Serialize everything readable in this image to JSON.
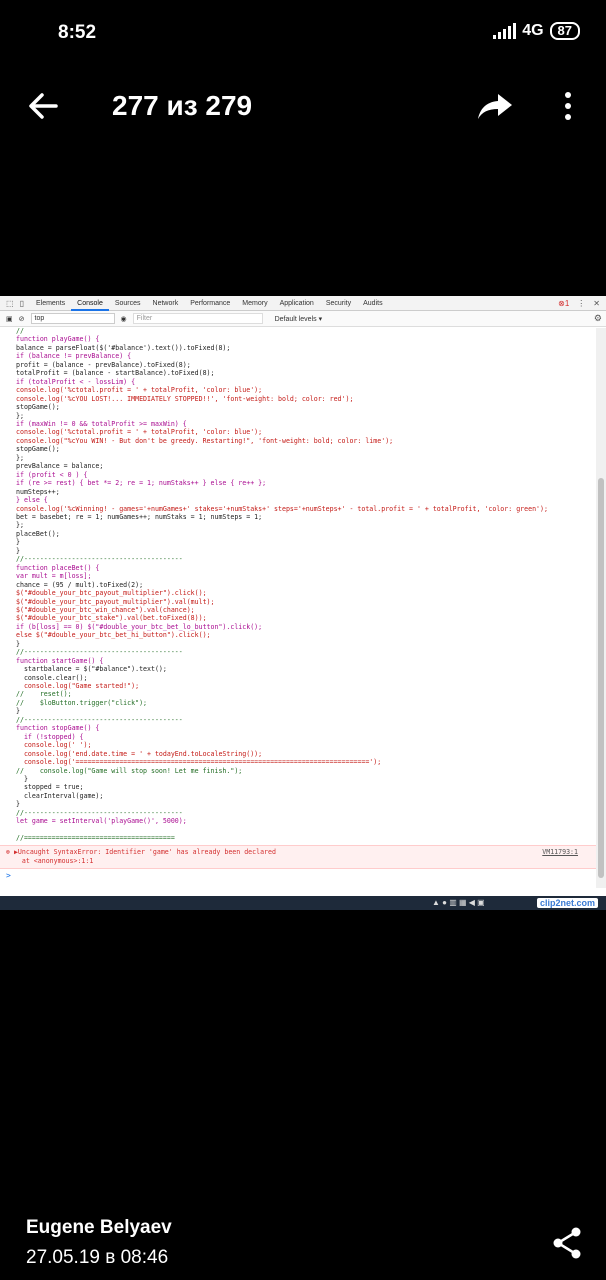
{
  "status_bar": {
    "time": "8:52",
    "network": "4G",
    "battery": "87"
  },
  "app_bar": {
    "counter": "277 из 279"
  },
  "photo": {
    "devtools": {
      "tabs": [
        "Elements",
        "Console",
        "Sources",
        "Network",
        "Performance",
        "Memory",
        "Application",
        "Security",
        "Audits"
      ],
      "active_tab": "Console",
      "error_count": "1",
      "context": "top",
      "filter_placeholder": "Filter",
      "levels": "Default levels ▾"
    },
    "code_lines": [
      "//",
      "function playGame() {",
      "balance = parseFloat($('#balance').text()).toFixed(8);",
      "if (balance != prevBalance) {",
      "profit = (balance - prevBalance).toFixed(8);",
      "totalProfit = (balance - startBalance).toFixed(8);",
      "if (totalProfit < - lossLim) {",
      "console.log('%ctotal.profit = ' + totalProfit, 'color: blue');",
      "console.log('%cYOU LOST!... IMMEDIATELY STOPPED!!', 'font-weight: bold; color: red');",
      "stopGame();",
      "};",
      "if (maxWin != 0 && totalProfit >= maxWin) {",
      "console.log('%ctotal.profit = ' + totalProfit, 'color: blue');",
      "console.log(\"%cYou WIN! - But don't be greedy. Restarting!\", 'font-weight: bold; color: lime');",
      "stopGame();",
      "};",
      "prevBalance = balance;",
      "if (profit < 0 ) {",
      "if (re >= rest) { bet *= 2; re = 1; numStaks++ } else { re++ };",
      "numSteps++;",
      "} else {",
      "console.log('%cWinning! - games='+numGames+' stakes='+numStaks+' steps='+numSteps+' - total.profit = ' + totalProfit, 'color: green');",
      "bet = basebet; re = 1; numGames++; numStaks = 1; numSteps = 1;",
      "};",
      "placeBet();",
      "}",
      "}",
      "//----------------------------------------",
      "function placeBet() {",
      "var mult = m[loss];",
      "chance = (95 / mult).toFixed(2);",
      "$(\"#double_your_btc_payout_multiplier\").click();",
      "$(\"#double_your_btc_payout_multiplier\").val(mult);",
      "$(\"#double_your_btc_win_chance\").val(chance);",
      "$(\"#double_your_btc_stake\").val(bet.toFixed(8));",
      "if (b[loss] == 0) $(\"#double_your_btc_bet_lo_button\").click();",
      "else $(\"#double_your_btc_bet_hi_button\").click();",
      "}",
      "//----------------------------------------",
      "function startGame() {",
      "  startbalance = $(\"#balance\").text();",
      "  console.clear();",
      "  console.log(\"Game started!\");",
      "//    reset();",
      "//    $loButton.trigger(\"click\");",
      "}",
      "//----------------------------------------",
      "function stopGame() {",
      "  if (!stopped) {",
      "  console.log(' ');",
      "  console.log('end.date.time = ' + todayEnd.toLocaleString());",
      "  console.log('==========================================================================');",
      "//    console.log(\"Game will stop soon! Let me finish.\");",
      "  }",
      "  stopped = true;",
      "  clearInterval(game);",
      "}",
      "//----------------------------------------",
      "let game = setInterval('playGame()', 5000);",
      "",
      "//======================================"
    ],
    "error_message": "▶Uncaught SyntaxError: Identifier 'game' has already been declared",
    "error_trace": "    at <anonymous>:1:1",
    "error_location": "VM11793:1",
    "prompt": ">",
    "watermark": "clip2net.com"
  },
  "footer": {
    "author": "Eugene Belyaev",
    "date": "27.05.19 в 08:46"
  },
  "colors": {
    "background": "#000000",
    "accent": "#1a73e8",
    "error": "#d32f2f"
  }
}
